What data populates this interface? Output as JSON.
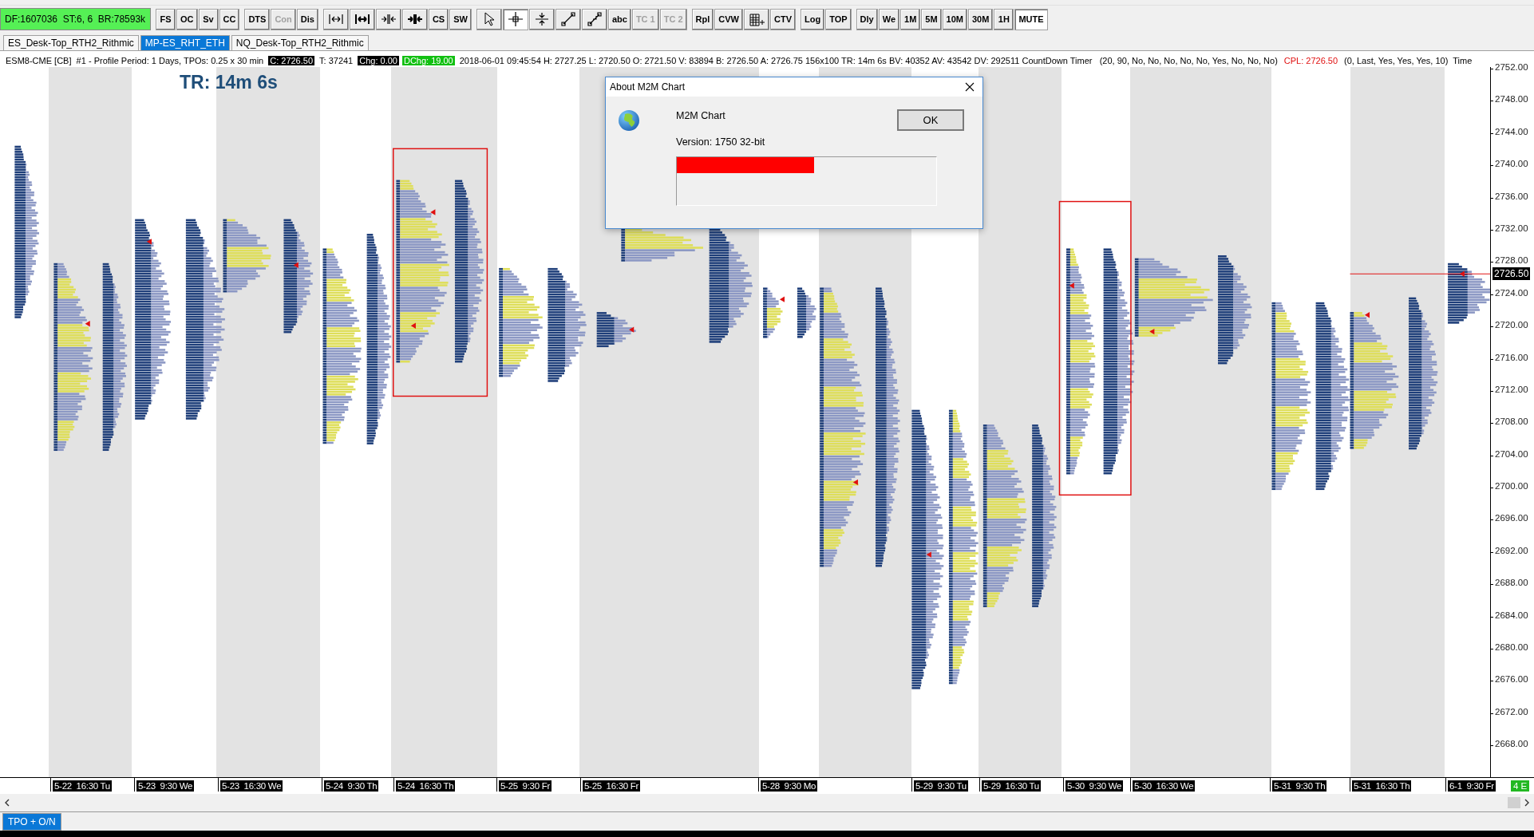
{
  "status_box": {
    "text": "DF:1607036  ST:6, 6  BR:78593k"
  },
  "toolbar": {
    "groups": [
      [
        {
          "kind": "text",
          "label": "FS",
          "selected": false,
          "disabled": false
        },
        {
          "kind": "text",
          "label": "OC",
          "selected": false,
          "disabled": false
        },
        {
          "kind": "text",
          "label": "Sv",
          "selected": false,
          "disabled": false
        },
        {
          "kind": "text",
          "label": "CC",
          "selected": false,
          "disabled": false
        }
      ],
      [
        {
          "kind": "text",
          "label": "DTS",
          "selected": false,
          "disabled": false
        },
        {
          "kind": "text",
          "label": "Con",
          "selected": false,
          "disabled": true
        },
        {
          "kind": "text",
          "label": "Dis",
          "selected": false,
          "disabled": false
        }
      ],
      [
        {
          "kind": "icon",
          "selected": false,
          "disabled": false
        },
        {
          "kind": "icon",
          "selected": false,
          "disabled": false
        },
        {
          "kind": "icon",
          "selected": false,
          "disabled": false
        },
        {
          "kind": "icon",
          "selected": false,
          "disabled": false
        },
        {
          "kind": "text",
          "label": "CS",
          "selected": false,
          "disabled": false
        },
        {
          "kind": "text",
          "label": "SW",
          "selected": false,
          "disabled": false
        }
      ],
      [
        {
          "kind": "icon",
          "selected": false,
          "disabled": false
        },
        {
          "kind": "icon",
          "selected": true,
          "disabled": false
        },
        {
          "kind": "icon",
          "selected": false,
          "disabled": false
        },
        {
          "kind": "icon",
          "selected": false,
          "disabled": false
        },
        {
          "kind": "icon",
          "selected": false,
          "disabled": false
        },
        {
          "kind": "text",
          "label": "abc",
          "selected": false,
          "disabled": false
        },
        {
          "kind": "text",
          "label": "TC 1",
          "selected": false,
          "disabled": true
        },
        {
          "kind": "text",
          "label": "TC 2",
          "selected": false,
          "disabled": true
        }
      ],
      [
        {
          "kind": "text",
          "label": "Rpl",
          "selected": false,
          "disabled": false
        },
        {
          "kind": "text",
          "label": "CVW",
          "selected": false,
          "disabled": false
        },
        {
          "kind": "icon",
          "selected": false,
          "disabled": false
        },
        {
          "kind": "text",
          "label": "CTV",
          "selected": false,
          "disabled": false
        }
      ],
      [
        {
          "kind": "text",
          "label": "Log",
          "selected": false,
          "disabled": false
        },
        {
          "kind": "text",
          "label": "TOP",
          "selected": false,
          "disabled": false
        }
      ],
      [
        {
          "kind": "text",
          "label": "Dly",
          "selected": false,
          "disabled": false
        },
        {
          "kind": "text",
          "label": "We",
          "selected": false,
          "disabled": false
        },
        {
          "kind": "text",
          "label": "1M",
          "selected": false,
          "disabled": false
        },
        {
          "kind": "text",
          "label": "5M",
          "selected": false,
          "disabled": false
        },
        {
          "kind": "text",
          "label": "10M",
          "selected": false,
          "disabled": false
        },
        {
          "kind": "text",
          "label": "30M",
          "selected": false,
          "disabled": false
        },
        {
          "kind": "text",
          "label": "1H",
          "selected": false,
          "disabled": false
        },
        {
          "kind": "text",
          "label": "MUTE",
          "selected": true,
          "disabled": false
        }
      ]
    ]
  },
  "tabs": [
    {
      "label": "ES_Desk-Top_RTH2_Rithmic",
      "selected": false
    },
    {
      "label": "MP-ES_RHT_ETH",
      "selected": true
    },
    {
      "label": "NQ_Desk-Top_RTH2_Rithmic",
      "selected": false
    }
  ],
  "info_line": [
    {
      "kind": "plain",
      "text": "ESM8-CME [CB]  #1 - Profile Period: 1 Days, TPOs: 0.25 x 30 min"
    },
    {
      "kind": "inverse",
      "text": "C: 2726.50"
    },
    {
      "kind": "plain",
      "text": "T: 37241"
    },
    {
      "kind": "inverse",
      "text": "Chg: 0.00"
    },
    {
      "kind": "green",
      "text": "DChg: 19.00"
    },
    {
      "kind": "plain",
      "text": "2018-06-01 09:45:54 H: 2727.25 L: 2720.50 O: 2721.50 V: 83894 B: 2726.50 A: 2726.75 156x100 TR: 14m 6s BV: 40352 AV: 43542 DV: 292511 CountDown Timer   (20, 90, No, No, No, No, No, Yes, No, No, No)"
    },
    {
      "kind": "red",
      "text": "CPL: 2726.50"
    },
    {
      "kind": "plain",
      "text": "(0, Last, Yes, Yes, Yes, 10)  Time"
    }
  ],
  "chart": {
    "timer_label": "TR: 14m 6s",
    "price_axis": {
      "labels": [
        "2752.00",
        "2748.00",
        "2744.00",
        "2740.00",
        "2736.00",
        "2732.00",
        "2728.00",
        "2724.00",
        "2720.00",
        "2716.00",
        "2712.00",
        "2708.00",
        "2704.00",
        "2700.00",
        "2696.00",
        "2692.00",
        "2688.00",
        "2684.00",
        "2680.00",
        "2676.00",
        "2672.00",
        "2668.00"
      ]
    },
    "current_price": "2726.50",
    "time_axis": {
      "labels": [
        "5-22  16:30 Tu",
        "5-23  9:30 We",
        "5-23  16:30 We",
        "5-24  9:30 Th",
        "5-24  16:30 Th",
        "5-25  9:30 Fr",
        "5-25  16:30 Fr",
        "5-28  9:30 Mo",
        "5-29  9:30 Tu",
        "5-29  16:30 Tu",
        "5-30  9:30 We",
        "5-30  16:30 We",
        "5-31  9:30 Th",
        "5-31  16:30 Th",
        "6-1  9:30 Fr"
      ]
    },
    "badge": "4 E"
  },
  "dialog": {
    "title": "About M2M Chart",
    "app_name": "M2M Chart",
    "version": "Version: 1750 32-bit",
    "ok_button": "OK",
    "progress": {
      "level": 0.53
    }
  },
  "bottom_tabs": [
    {
      "label": "TPO + O/N",
      "selected": true
    }
  ]
}
